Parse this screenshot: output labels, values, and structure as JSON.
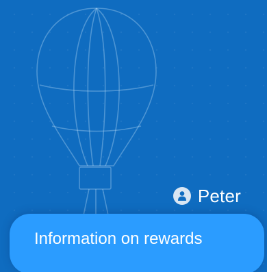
{
  "user": {
    "name": "Peter",
    "avatar_icon": "person-icon"
  },
  "rewards_button": {
    "label": "Information on rewards"
  },
  "decoration": {
    "illustration_icon": "hot-air-balloon-icon"
  },
  "colors": {
    "background": "#0f6cc0",
    "button": "#2b9cff",
    "text": "#ffffff"
  }
}
